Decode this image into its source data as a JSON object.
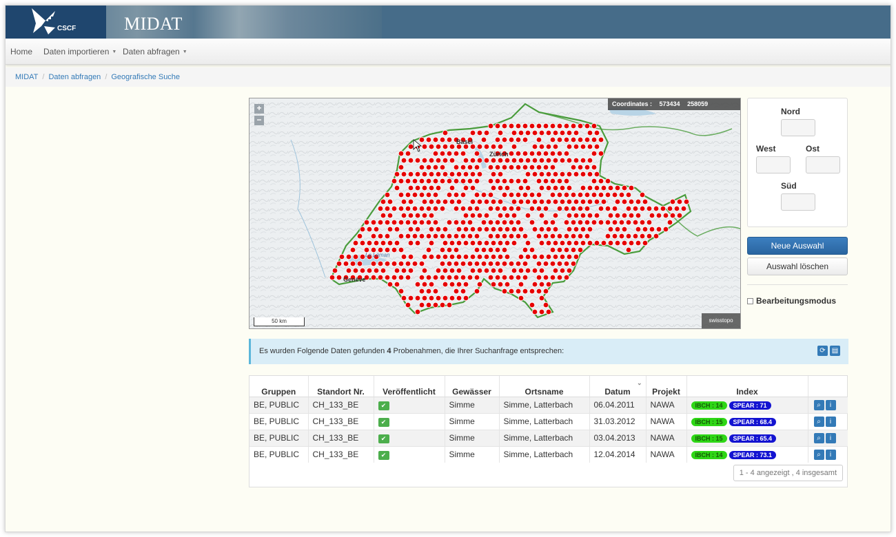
{
  "header": {
    "logo_text": "CSCF",
    "app_title": "MIDAT"
  },
  "nav": {
    "items": [
      {
        "label": "Home"
      },
      {
        "label": "Daten importieren"
      },
      {
        "label": "Daten abfragen"
      }
    ]
  },
  "breadcrumb": [
    "MIDAT",
    "Daten abfragen",
    "Geografische Suche"
  ],
  "map": {
    "coordinates_label": "Coordinates :",
    "coord_x": "573434",
    "coord_y": "258059",
    "scale_label": "50 km",
    "attribution": "swisstopo",
    "zoom_in": "+",
    "zoom_out": "−",
    "places": [
      "Genève",
      "Zürich",
      "Basel",
      "Le Léman"
    ]
  },
  "panel": {
    "nord": "Nord",
    "west": "West",
    "ost": "Ost",
    "sued": "Süd",
    "new_selection": "Neue Auswahl",
    "clear_selection": "Auswahl löschen",
    "edit_mode": "Bearbeitungsmodus"
  },
  "alert": {
    "text_before": "Es wurden Folgende Daten gefunden ",
    "count": "4",
    "text_after": " Probenahmen, die Ihrer Suchanfrage entsprechen:"
  },
  "table": {
    "headers": [
      "Gruppen",
      "Standort Nr.",
      "Veröffentlicht",
      "Gewässer",
      "Ortsname",
      "Datum",
      "Projekt",
      "Index",
      ""
    ],
    "rows": [
      {
        "gruppen": "BE, PUBLIC",
        "standort": "CH_133_BE",
        "gewaesser": "Simme",
        "ortsname": "Simme, Latterbach",
        "datum": "06.04.2011",
        "projekt": "NAWA",
        "ibch": "IBCH : 14",
        "spear": "SPEAR : 71"
      },
      {
        "gruppen": "BE, PUBLIC",
        "standort": "CH_133_BE",
        "gewaesser": "Simme",
        "ortsname": "Simme, Latterbach",
        "datum": "31.03.2012",
        "projekt": "NAWA",
        "ibch": "IBCH : 15",
        "spear": "SPEAR : 68.4"
      },
      {
        "gruppen": "BE, PUBLIC",
        "standort": "CH_133_BE",
        "gewaesser": "Simme",
        "ortsname": "Simme, Latterbach",
        "datum": "03.04.2013",
        "projekt": "NAWA",
        "ibch": "IBCH : 15",
        "spear": "SPEAR : 65.4"
      },
      {
        "gruppen": "BE, PUBLIC",
        "standort": "CH_133_BE",
        "gewaesser": "Simme",
        "ortsname": "Simme, Latterbach",
        "datum": "12.04.2014",
        "projekt": "NAWA",
        "ibch": "IBCH : 14",
        "spear": "SPEAR : 73.1"
      }
    ],
    "pager": "1 - 4 angezeigt , 4 insgesamt"
  },
  "colors": {
    "banner": "#466c89",
    "primary": "#337ab7",
    "point": "#e60000",
    "border_green": "#4a9c3c"
  }
}
